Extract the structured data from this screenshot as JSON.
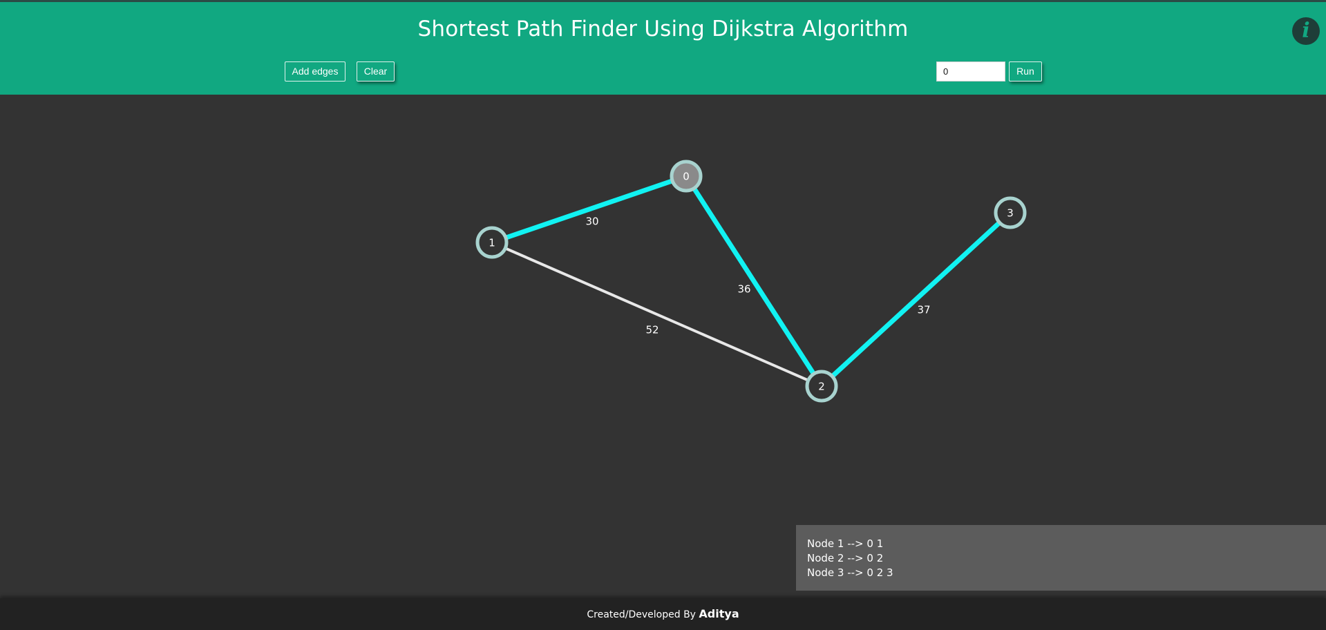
{
  "header": {
    "title": "Shortest Path Finder Using Dijkstra Algorithm",
    "add_edges_label": "Add edges",
    "clear_label": "Clear",
    "source_value": "0",
    "run_label": "Run",
    "info_icon": "info-icon",
    "background_color": "#11a881"
  },
  "graph": {
    "nodes": [
      {
        "id": "0",
        "label": "0",
        "is_source": true
      },
      {
        "id": "1",
        "label": "1",
        "is_source": false
      },
      {
        "id": "2",
        "label": "2",
        "is_source": false
      },
      {
        "id": "3",
        "label": "3",
        "is_source": false
      }
    ],
    "edges": [
      {
        "from": "0",
        "to": "1",
        "weight": "30",
        "on_shortest_path": true
      },
      {
        "from": "0",
        "to": "2",
        "weight": "36",
        "on_shortest_path": true
      },
      {
        "from": "2",
        "to": "3",
        "weight": "37",
        "on_shortest_path": true
      },
      {
        "from": "1",
        "to": "2",
        "weight": "52",
        "on_shortest_path": false
      }
    ],
    "colors": {
      "path_edge": "#11f2f2",
      "normal_edge": "#e8e8e8",
      "node_border": "#a8d3cf",
      "node_fill": "#333333",
      "source_fill": "#8a8a8a",
      "text": "#ffffff"
    }
  },
  "output": {
    "lines": [
      "Node 1 --> 0 1",
      "Node 2 --> 0 2",
      "Node 3 --> 0 2 3"
    ]
  },
  "footer": {
    "prefix": "Created/Developed By ",
    "author": "Aditya"
  }
}
